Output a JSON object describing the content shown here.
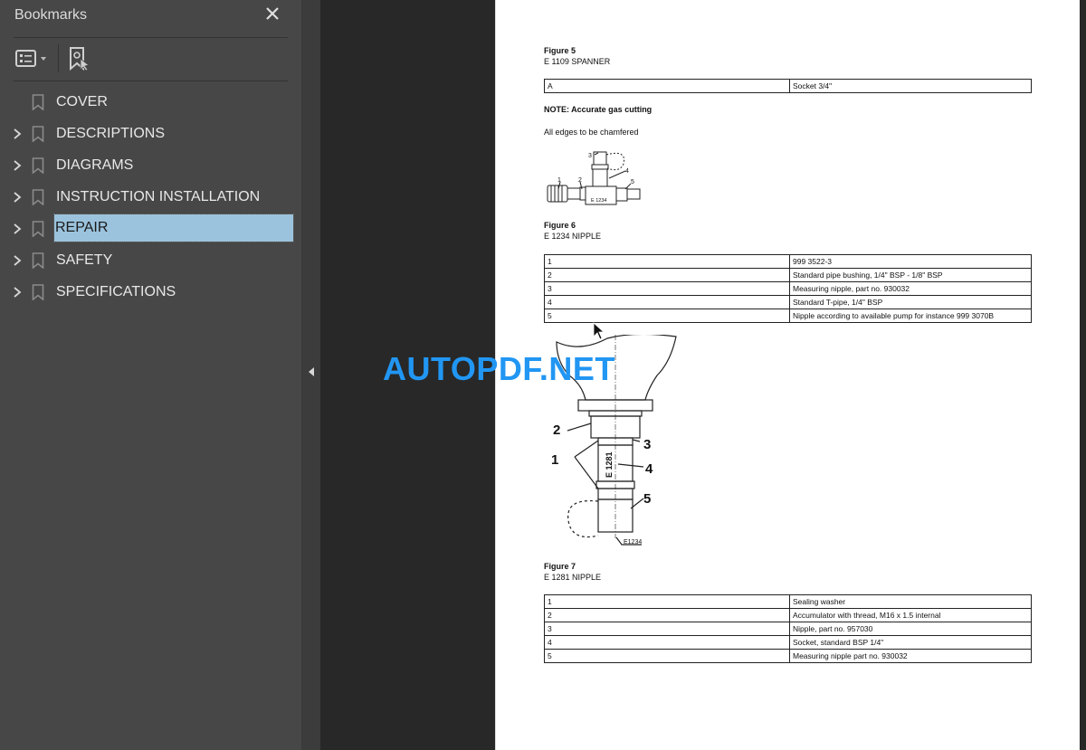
{
  "sidebar": {
    "title": "Bookmarks",
    "close_icon": "close-icon",
    "toolbar": {
      "options_icon": "list-options-icon",
      "find_bookmark_icon": "find-current-bookmark-icon"
    },
    "items": [
      {
        "label": "COVER",
        "expandable": false,
        "selected": false
      },
      {
        "label": "DESCRIPTIONS",
        "expandable": true,
        "selected": false
      },
      {
        "label": "DIAGRAMS",
        "expandable": true,
        "selected": false
      },
      {
        "label": "INSTRUCTION INSTALLATION",
        "expandable": true,
        "selected": false
      },
      {
        "label": "REPAIR",
        "expandable": true,
        "selected": true
      },
      {
        "label": "SAFETY",
        "expandable": true,
        "selected": false
      },
      {
        "label": "SPECIFICATIONS",
        "expandable": true,
        "selected": false
      }
    ],
    "selection_color": "#9bc3dd"
  },
  "document": {
    "figure5": {
      "title": "Figure 5",
      "caption": "E 1109 SPANNER",
      "rows": [
        [
          "A",
          "Socket 3/4\""
        ]
      ],
      "note": "NOTE: Accurate gas cutting",
      "text": "All edges to be chamfered"
    },
    "figure6": {
      "title": "Figure 6",
      "caption": "E 1234 NIPPLE",
      "image_label": "E 1234",
      "callouts": [
        "1",
        "2",
        "3",
        "4",
        "5"
      ],
      "rows": [
        [
          "1",
          "999 3522-3"
        ],
        [
          "2",
          "Standard pipe bushing, 1/4\" BSP - 1/8\" BSP"
        ],
        [
          "3",
          "Measuring nipple, part no. 930032"
        ],
        [
          "4",
          "Standard T-pipe, 1/4\" BSP"
        ],
        [
          "5",
          "Nipple according to available pump for instance 999 3070B"
        ]
      ]
    },
    "figure7": {
      "title": "Figure 7",
      "caption": "E 1281 NIPPLE",
      "image_label": "E1281",
      "image_sub_label": "E1234",
      "callouts": [
        "1",
        "2",
        "3",
        "4",
        "5"
      ],
      "rows": [
        [
          "1",
          "Sealing washer"
        ],
        [
          "2",
          "Accumulator with thread, M16 x 1.5 internal"
        ],
        [
          "3",
          "Nipple, part no. 957030"
        ],
        [
          "4",
          "Socket, standard BSP 1/4\""
        ],
        [
          "5",
          "Measuring nipple part no. 930032"
        ]
      ]
    }
  },
  "watermark": {
    "text": "AUTOPDF.NET",
    "color": "#2196f3"
  }
}
